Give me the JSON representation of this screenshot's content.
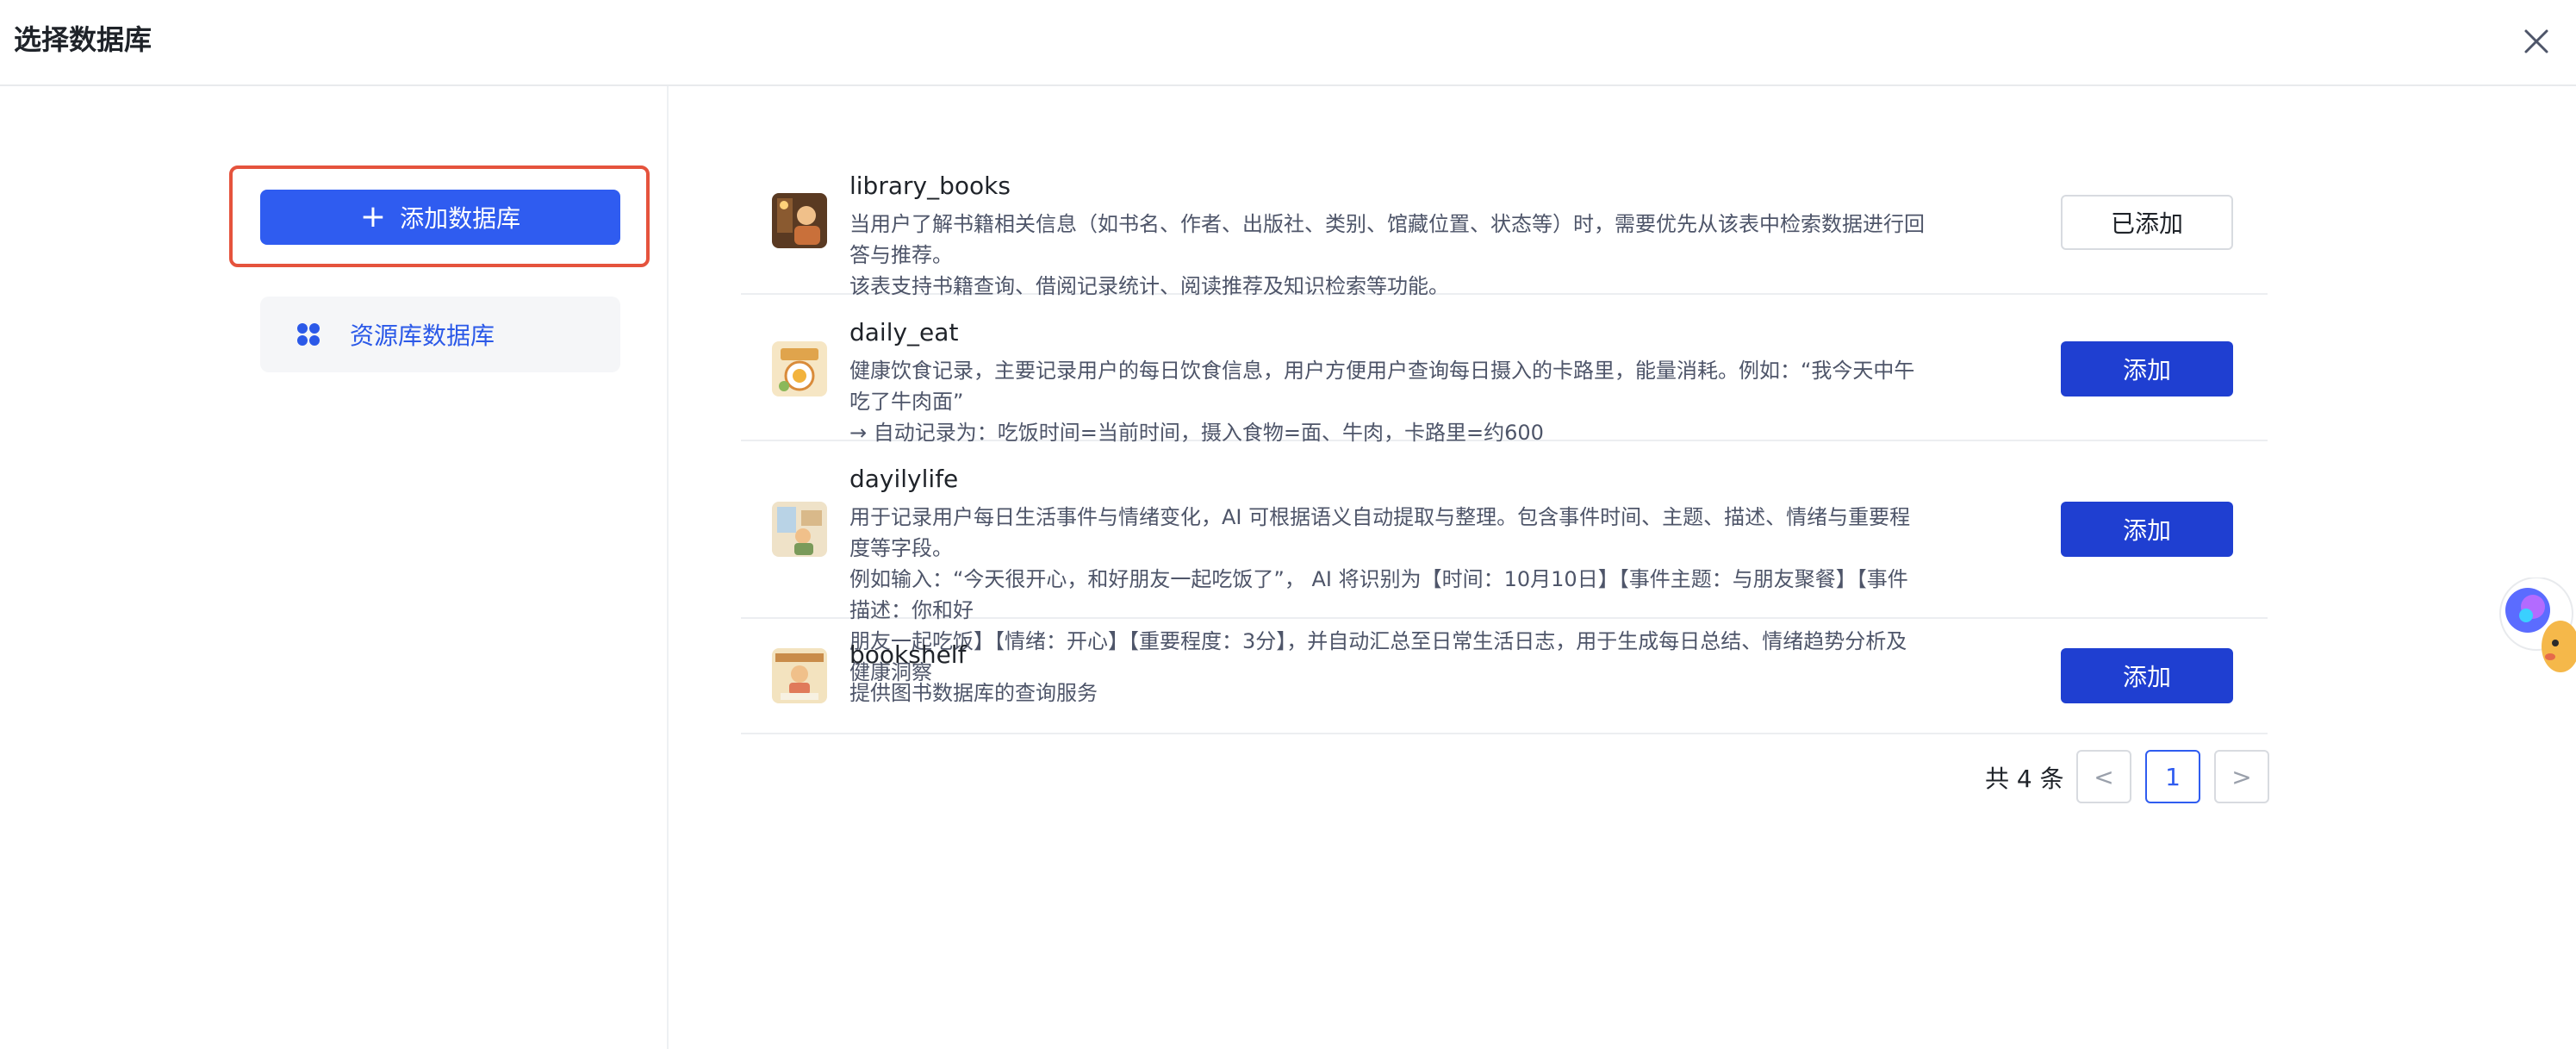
{
  "modal": {
    "title": "选择数据库"
  },
  "sidebar": {
    "add_button_label": "添加数据库",
    "resource_button_label": "资源库数据库"
  },
  "databases": [
    {
      "name": "library_books",
      "desc_lines": [
        "当用户了解书籍相关信息（如书名、作者、出版社、类别、馆藏位置、状态等）时，需要优先从该表中检索数据进行回答与推荐。",
        "该表支持书籍查询、借阅记录统计、阅读推荐及知识检索等功能。"
      ],
      "button_label": "已添加",
      "added": true
    },
    {
      "name": "daily_eat",
      "desc_lines": [
        "健康饮食记录，主要记录用户的每日饮食信息，用户方便用户查询每日摄入的卡路里，能量消耗。例如：“我今天中午吃了牛肉面”",
        "→ 自动记录为：吃饭时间=当前时间，摄入食物=面、牛肉，卡路里=约600"
      ],
      "button_label": "添加",
      "added": false
    },
    {
      "name": "dayilylife",
      "desc_lines": [
        "用于记录用户每日生活事件与情绪变化，AI 可根据语义自动提取与整理。包含事件时间、主题、描述、情绪与重要程度等字段。",
        "例如输入：“今天很开心，和好朋友一起吃饭了”， AI 将识别为【时间：10月10日】【事件主题：与朋友聚餐】【事件描述：你和好",
        "朋友一起吃饭】【情绪：开心】【重要程度：3分】，并自动汇总至日常生活日志，用于生成每日总结、情绪趋势分析及健康洞察"
      ],
      "button_label": "添加",
      "added": false
    },
    {
      "name": "bookshelf",
      "desc_lines": [
        "提供图书数据库的查询服务"
      ],
      "button_label": "添加",
      "added": false
    }
  ],
  "pagination": {
    "total_text": "共 4 条",
    "current_page": "1",
    "prev_symbol": "<",
    "next_symbol": ">"
  },
  "colors": {
    "primary": "#2f5cf0",
    "add_button": "#1f3fd1",
    "highlight": "#e5533d"
  }
}
